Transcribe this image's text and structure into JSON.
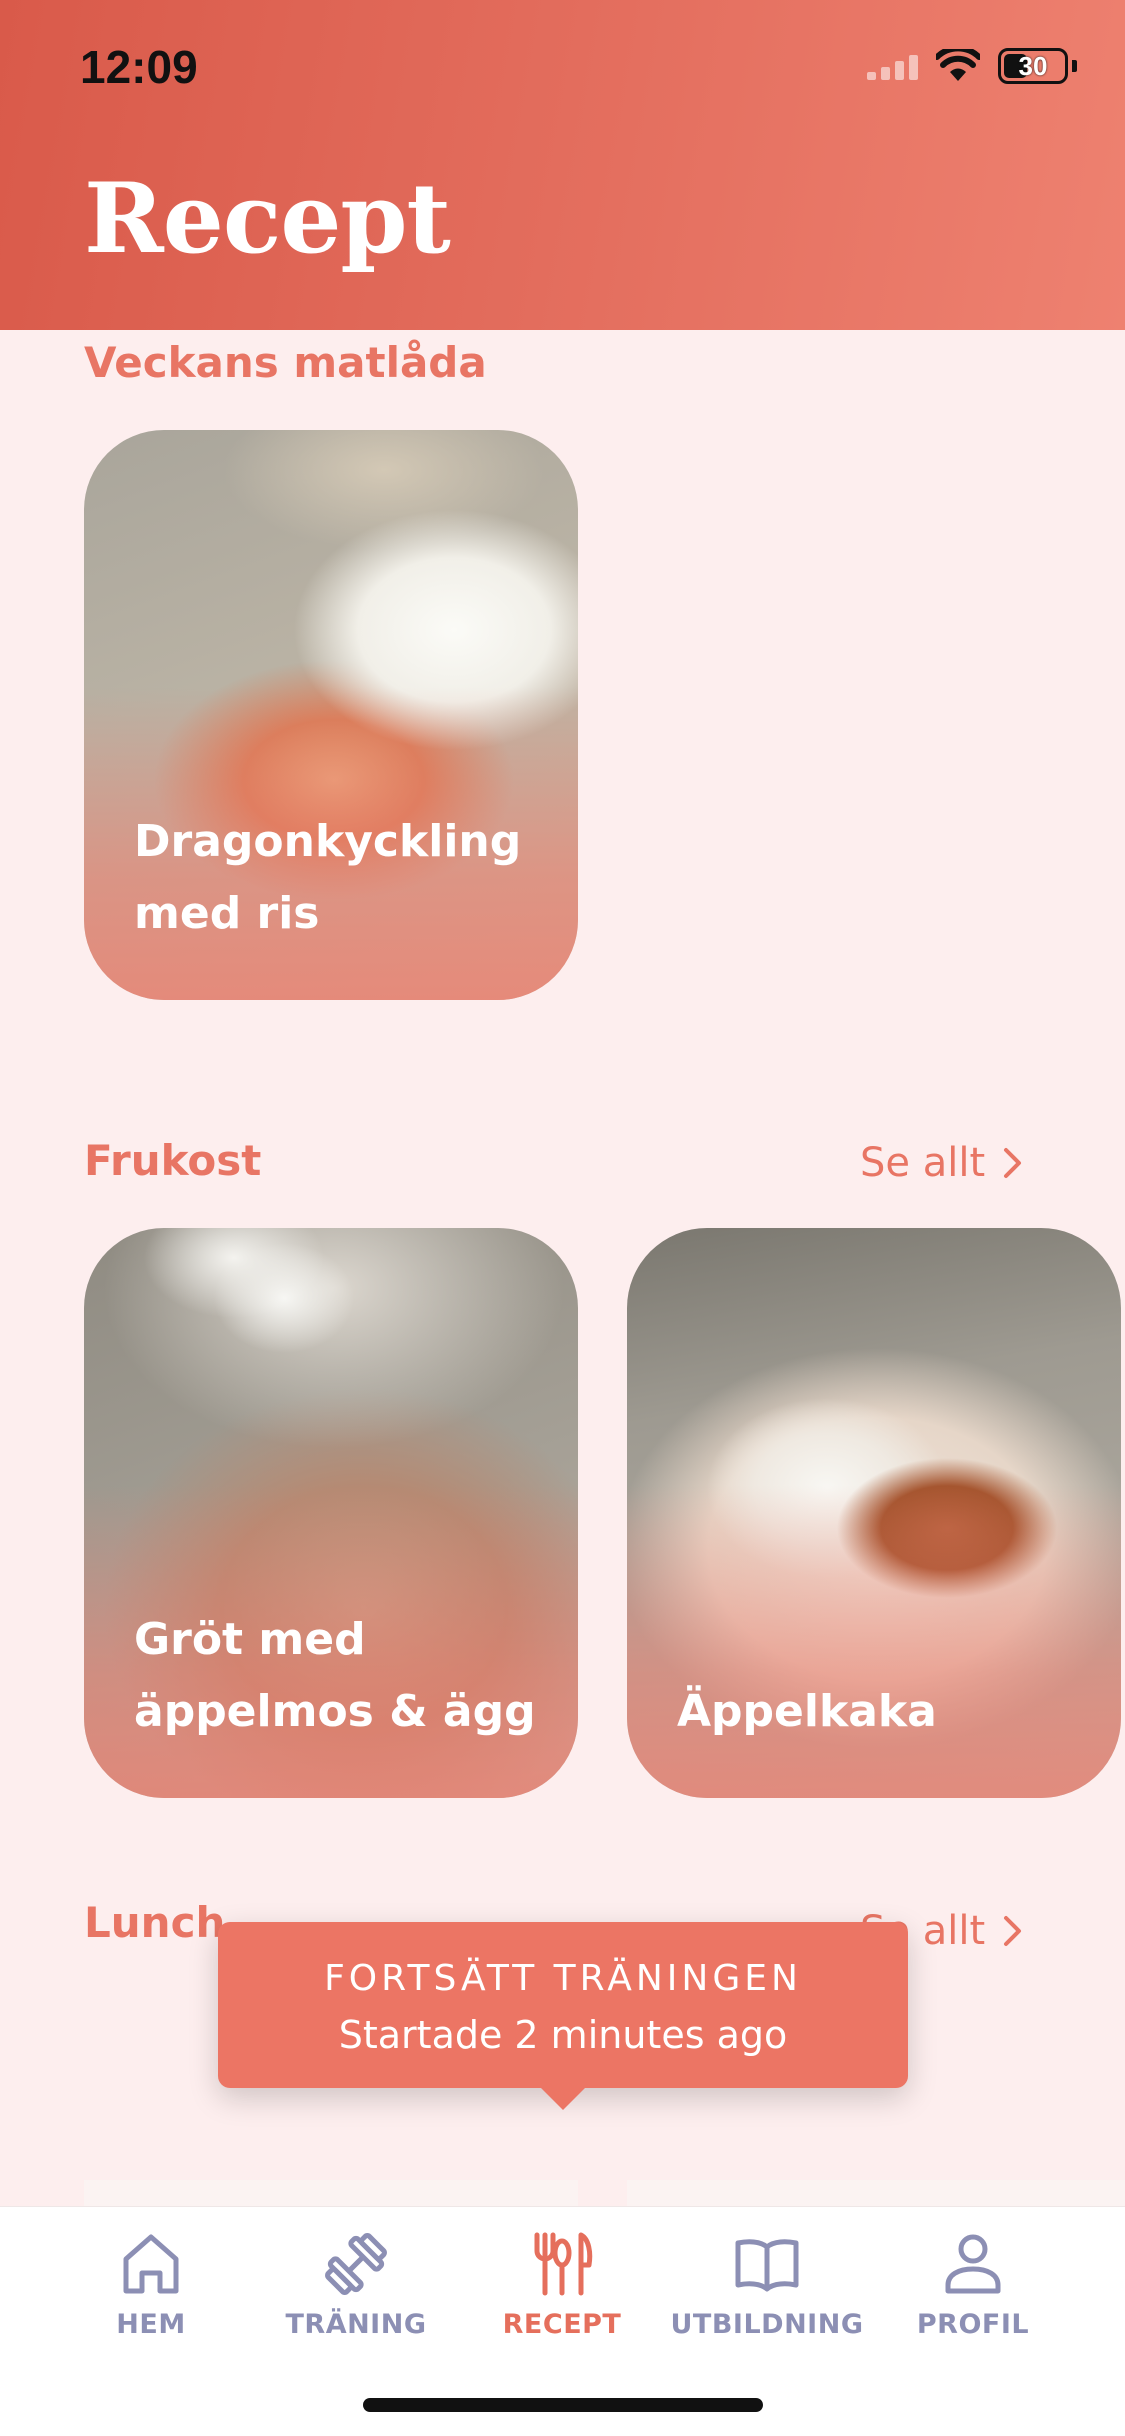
{
  "status_bar": {
    "time": "12:09",
    "battery": "30"
  },
  "header": {
    "title": "Recept"
  },
  "sections": {
    "weekly": {
      "title": "Veckans matlåda",
      "cards": [
        {
          "title": "Dragonkyckling med ris"
        }
      ]
    },
    "breakfast": {
      "title": "Frukost",
      "see_all": "Se allt",
      "cards": [
        {
          "title": "Gröt med äppelmos & ägg"
        },
        {
          "title": "Äppelkaka"
        }
      ]
    },
    "lunch": {
      "title": "Lunch",
      "see_all": "Se allt"
    }
  },
  "toast": {
    "title": "FORTSÄTT TRÄNINGEN",
    "subtitle": "Startade 2 minutes ago"
  },
  "tabbar": {
    "items": [
      {
        "label": "HEM",
        "icon": "home-icon"
      },
      {
        "label": "TRÄNING",
        "icon": "dumbbell-icon"
      },
      {
        "label": "RECEPT",
        "icon": "utensils-icon",
        "active": true
      },
      {
        "label": "UTBILDNING",
        "icon": "book-icon"
      },
      {
        "label": "PROFIL",
        "icon": "person-icon"
      }
    ]
  },
  "colors": {
    "accent": "#e87564",
    "header": "#e0614f",
    "inactive": "#8c8fb4",
    "background": "#fdeeee"
  }
}
